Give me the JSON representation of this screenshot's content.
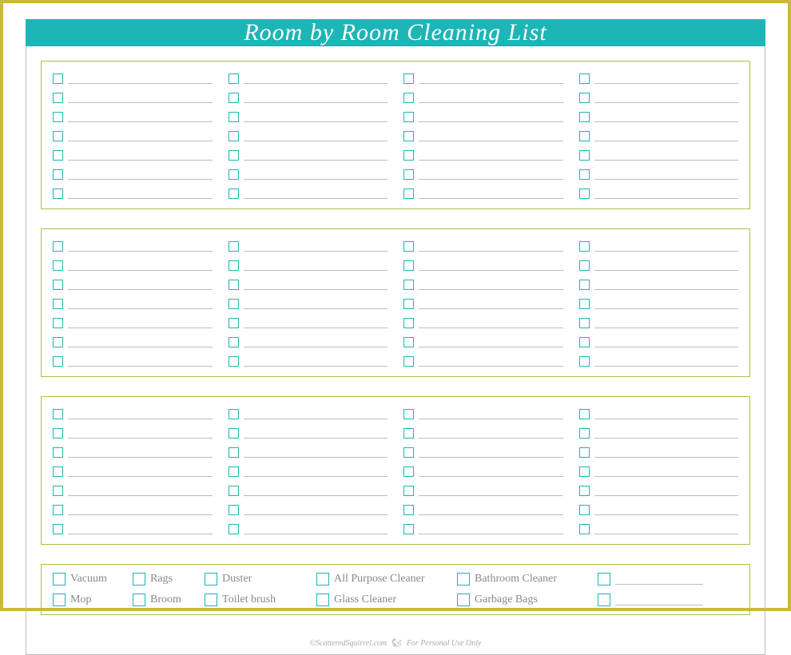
{
  "title": "Room by Room Cleaning List",
  "sections": [
    {
      "columns": 4,
      "rows": 7
    },
    {
      "columns": 4,
      "rows": 7
    },
    {
      "columns": 4,
      "rows": 7
    }
  ],
  "supplies": {
    "col1": [
      "Vacuum",
      "Mop"
    ],
    "col2": [
      "Rags",
      "Broom"
    ],
    "col3": [
      "Duster",
      "Toilet brush"
    ],
    "col4": [
      "All Purpose Cleaner",
      "Glass Cleaner"
    ],
    "col5": [
      "Bathroom Cleaner",
      "Garbage Bags"
    ],
    "blank_lines": 2
  },
  "footer": {
    "copyright": "©ScatteredSquirrel.com",
    "note": "For Personal Use Only"
  }
}
